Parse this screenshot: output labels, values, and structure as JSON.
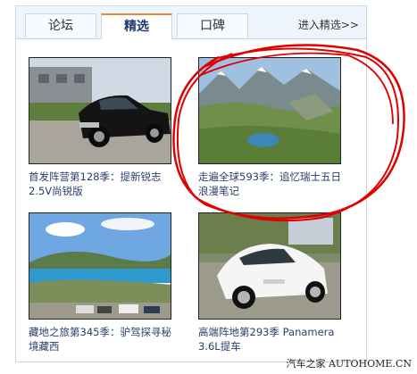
{
  "tabs": [
    {
      "label": "论坛"
    },
    {
      "label": "精选"
    },
    {
      "label": "口碑"
    }
  ],
  "more_link": "进入精选>>",
  "cards": [
    {
      "caption": "首发阵营第128季：提新锐志2.5V尚锐版",
      "thumb": "black-sedan-photo"
    },
    {
      "caption": "走遍全球593季：追忆瑞士五日浪漫笔记",
      "thumb": "swiss-mountain-lake-photo"
    },
    {
      "caption": "藏地之旅第345季：驴驾探寻秘境藏西",
      "thumb": "tibet-lake-photo"
    },
    {
      "caption": "高端阵地第293季 Panamera 3.6L提车",
      "thumb": "white-porsche-photo"
    }
  ],
  "annotation": {
    "color": "#e00000",
    "shape": "hand-drawn-circle",
    "target": "card-2"
  },
  "watermark": "汽车之家 AUTOHOME.CN"
}
